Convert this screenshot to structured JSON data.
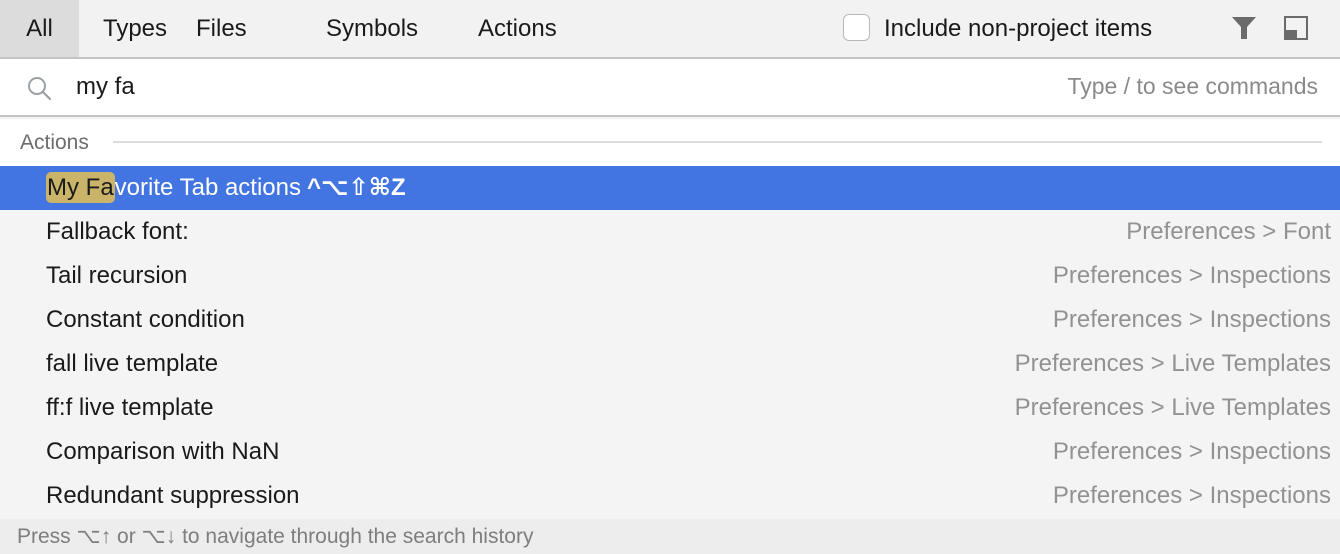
{
  "tabs": [
    {
      "label": "All",
      "active": true
    },
    {
      "label": "Types",
      "active": false
    },
    {
      "label": "Files",
      "active": false
    },
    {
      "label": "Symbols",
      "active": false
    },
    {
      "label": "Actions",
      "active": false
    }
  ],
  "toolbar": {
    "include_non_project_label": "Include non-project items",
    "include_non_project_checked": false,
    "filter_icon": "filter-icon",
    "preview_icon": "preview-panel-icon"
  },
  "search": {
    "value": "my fa",
    "hint": "Type / to see commands",
    "icon": "search-icon"
  },
  "section": {
    "label": "Actions"
  },
  "results": [
    {
      "match": "My Fa",
      "rest": "vorite Tab actions",
      "shortcut": "^⌥⇧⌘Z",
      "location": "",
      "selected": true
    },
    {
      "match": "",
      "rest": "Fallback font:",
      "shortcut": "",
      "location": "Preferences > Font",
      "selected": false
    },
    {
      "match": "",
      "rest": "Tail recursion",
      "shortcut": "",
      "location": "Preferences > Inspections",
      "selected": false
    },
    {
      "match": "",
      "rest": "Constant condition",
      "shortcut": "",
      "location": "Preferences > Inspections",
      "selected": false
    },
    {
      "match": "",
      "rest": "fall live template",
      "shortcut": "",
      "location": "Preferences > Live Templates",
      "selected": false
    },
    {
      "match": "",
      "rest": "ff:f live template",
      "shortcut": "",
      "location": "Preferences > Live Templates",
      "selected": false
    },
    {
      "match": "",
      "rest": "Comparison with NaN",
      "shortcut": "",
      "location": "Preferences > Inspections",
      "selected": false
    },
    {
      "match": "",
      "rest": "Redundant suppression",
      "shortcut": "",
      "location": "Preferences > Inspections",
      "selected": false
    }
  ],
  "footer": {
    "text": "Press ⌥↑ or ⌥↓ to navigate through the search history"
  },
  "colors": {
    "selection": "#4274e2",
    "match_highlight": "#c9b46a"
  }
}
